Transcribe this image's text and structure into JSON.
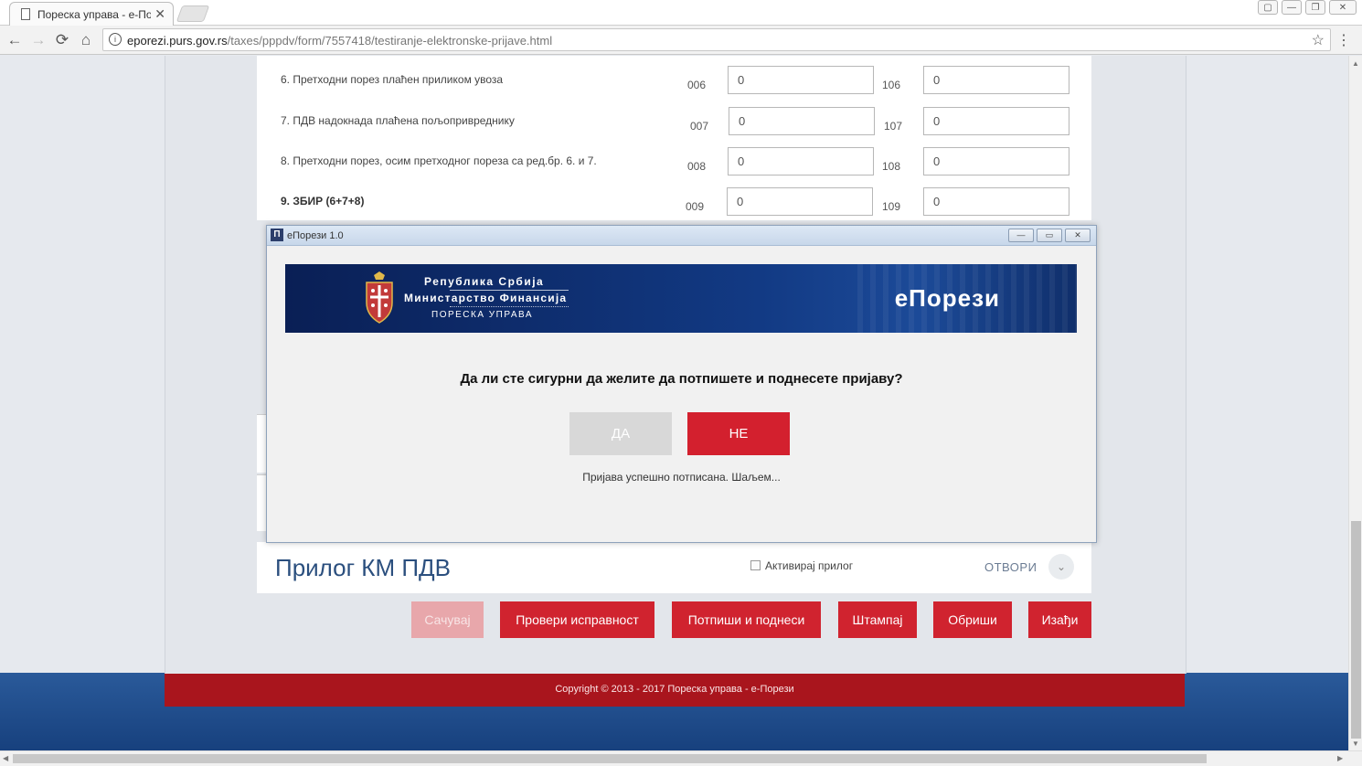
{
  "browser": {
    "tab_title": "Пореска управа - е-Пор",
    "tab_close": "✕",
    "url_host": "eporezi.purs.gov.rs",
    "url_path": "/taxes/pppdv/form/7557418/testiranje-elektronske-prijave.html",
    "info_glyph": "i",
    "back_glyph": "←",
    "forward_glyph": "→",
    "reload_glyph": "⟳",
    "home_glyph": "⌂",
    "star_glyph": "☆",
    "menu_glyph": "⋮",
    "window_controls": [
      "▢",
      "—",
      "❐",
      "✕"
    ]
  },
  "form": {
    "rows": [
      {
        "number_label": "6.   Претходни порез плаћен приликом увоза",
        "code_a": "006",
        "value_a": "0",
        "code_b": "106",
        "value_b": "0"
      },
      {
        "number_label": "7.   ПДВ надокнада плаћена пољопривреднику",
        "code_a": "007",
        "value_a": "0",
        "code_b": "107",
        "value_b": "0"
      },
      {
        "number_label": "8.   Претходни порез, осим претходног пореза са ред.бр. 6. и 7.",
        "code_a": "008",
        "value_a": "0",
        "code_b": "108",
        "value_b": "0"
      },
      {
        "number_label": "9.   ЗБИР (6+7+8)",
        "code_a": "009",
        "value_a": "0",
        "code_b": "109",
        "value_b": "0"
      }
    ]
  },
  "modal": {
    "app_icon": "П",
    "title": "еПорези 1.0",
    "controls": [
      "—",
      "▭",
      "✕"
    ],
    "banner": {
      "line1": "Република Србија",
      "line2": "Министарство Финансија",
      "line3": "ПОРЕСКА УПРАВА",
      "brand": "еПорези"
    },
    "question": "Да ли сте сигурни да желите да потпишете и поднесете пријаву?",
    "yes_label": "ДА",
    "no_label": "НЕ",
    "status": "Пријава успешно потписана. Шаљем..."
  },
  "attachment": {
    "title": "Прилог КМ ПДВ",
    "checkbox_label": "Активирај прилог",
    "open_label": "ОТВОРИ",
    "chevron_glyph": "⌄"
  },
  "actions": {
    "save": "Сачувај",
    "check": "Провери исправност",
    "sign_submit": "Потпиши и поднеси",
    "print": "Штампај",
    "delete": "Обриши",
    "exit": "Изађи"
  },
  "footer": {
    "copyright": "Copyright © 2013 - 2017 Пореска управа - е-Порези"
  },
  "scroll": {
    "up": "▲",
    "down": "▼",
    "left": "◀",
    "right": "▶"
  },
  "colors": {
    "accent_red": "#d0232f",
    "footer_red": "#a9151d",
    "banner_navy": "#0a1f55",
    "title_blue": "#2b4f7e"
  }
}
